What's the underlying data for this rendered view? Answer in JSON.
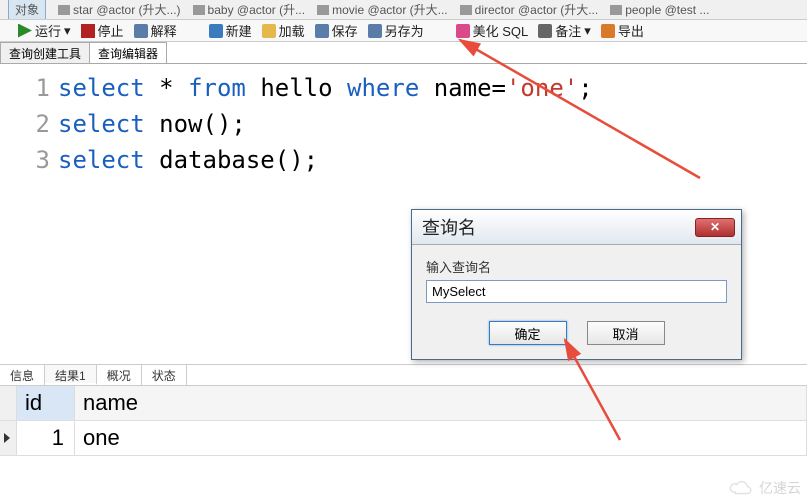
{
  "top_tabs": {
    "active": "对象",
    "items": [
      "star @actor (升大...)",
      "baby @actor (升...",
      "movie @actor (升大...",
      "director @actor (升大...",
      "people @test ..."
    ]
  },
  "toolbar": {
    "run": "运行",
    "stop": "停止",
    "explain": "解释",
    "new": "新建",
    "load": "加载",
    "save": "保存",
    "saveas": "另存为",
    "beautify": "美化 SQL",
    "note": "备注",
    "export": "导出"
  },
  "editor_tabs": {
    "builder": "查询创建工具",
    "editor": "查询编辑器"
  },
  "code": {
    "line1": {
      "num": "1",
      "kw1": "select",
      "star": "*",
      "kw2": "from",
      "ident": "hello",
      "kw3": "where",
      "ident2": "name",
      "eq": "=",
      "str": "'one'",
      "semi": ";"
    },
    "line2": {
      "num": "2",
      "kw1": "select",
      "fn": "now();"
    },
    "line3": {
      "num": "3",
      "kw1": "select",
      "fn": "database();"
    }
  },
  "dialog": {
    "title": "查询名",
    "label": "输入查询名",
    "input_value": "MySelect",
    "ok": "确定",
    "cancel": "取消"
  },
  "result_tabs": {
    "info": "信息",
    "result1": "结果1",
    "overview": "概况",
    "status": "状态"
  },
  "grid": {
    "headers": {
      "id": "id",
      "name": "name"
    },
    "rows": [
      {
        "id": "1",
        "name": "one"
      }
    ]
  },
  "watermark": "亿速云"
}
